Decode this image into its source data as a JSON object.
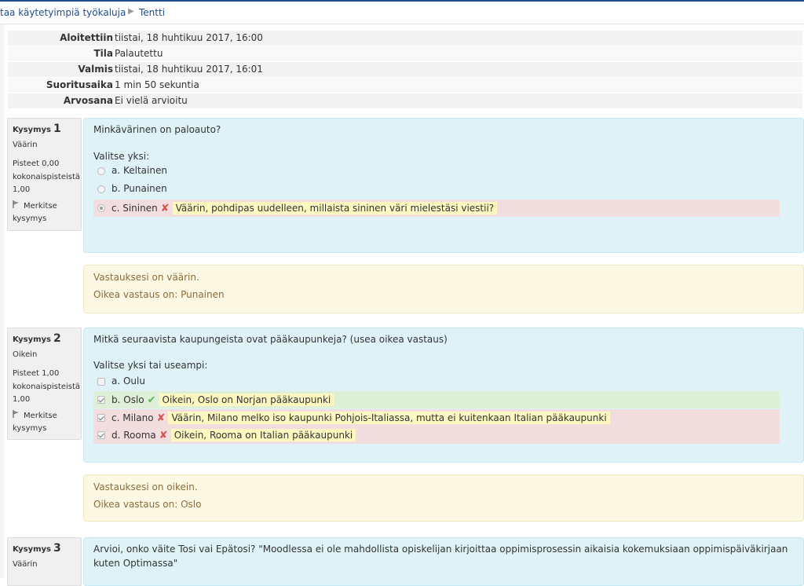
{
  "breadcrumb": {
    "items": [
      "taa käytetyimpiä työkaluja",
      "Tentti"
    ]
  },
  "summary": [
    {
      "label": "Aloitettiin",
      "value": "tiistai, 18 huhtikuu 2017, 16:00"
    },
    {
      "label": "Tila",
      "value": "Palautettu"
    },
    {
      "label": "Valmis",
      "value": "tiistai, 18 huhtikuu 2017, 16:01"
    },
    {
      "label": "Suoritusaika",
      "value": "1 min 50 sekuntia"
    },
    {
      "label": "Arvosana",
      "value": "Ei vielä arvioitu"
    }
  ],
  "questions": [
    {
      "word": "Kysymys",
      "number": "1",
      "state": "Väärin",
      "grade": "Pisteet 0,00 kokonaispisteistä 1,00",
      "flag": "Merkitse kysymys",
      "text": "Minkävärinen on paloauto?",
      "prompt": "Valitse yksi:",
      "answers": [
        {
          "label": "a. Keltainen",
          "feedback": ""
        },
        {
          "label": "b. Punainen",
          "feedback": ""
        },
        {
          "label": "c. Sininen",
          "feedback": "Väärin, pohdipas uudelleen, millaista sininen väri mielestäsi viestii?"
        }
      ],
      "result": "Vastauksesi on väärin.",
      "right": "Oikea vastaus on: Punainen"
    },
    {
      "word": "Kysymys",
      "number": "2",
      "state": "Oikein",
      "grade": "Pisteet 1,00 kokonaispisteistä 1,00",
      "flag": "Merkitse kysymys",
      "text": "Mitkä seuraavista kaupungeista ovat pääkaupunkeja? (usea oikea vastaus)",
      "prompt": "Valitse yksi tai useampi:",
      "answers": [
        {
          "label": "a. Oulu",
          "feedback": ""
        },
        {
          "label": "b. Oslo",
          "feedback": "Oikein, Oslo on Norjan pääkaupunki"
        },
        {
          "label": "c. Milano",
          "feedback": "Väärin, Milano melko iso kaupunki Pohjois-Italiassa, mutta ei kuitenkaan Italian pääkaupunki"
        },
        {
          "label": "d. Rooma",
          "feedback": "Oikein, Rooma on Italian pääkaupunki"
        }
      ],
      "result": "Vastauksesi on oikein.",
      "right": "Oikea vastaus on: Oslo"
    },
    {
      "word": "Kysymys",
      "number": "3",
      "state": "Väärin",
      "text_line1": "Arvioi, onko väite Tosi vai Epätosi? \"Moodlessa ei ole mahdollista opiskelijan kirjoittaa oppimisprosessin aikaisia kokemuksiaan oppimispäiväkirjaan",
      "text_line2": "kuten Optimassa\""
    }
  ],
  "colors": {
    "question_bg": "#def2f8",
    "feedback_bg": "#fcf8e3",
    "incorrect_bg": "#f2dede",
    "correct_bg": "#dff0d8",
    "wrong_mark": "#d9534f",
    "right_mark": "#5cb85c"
  }
}
